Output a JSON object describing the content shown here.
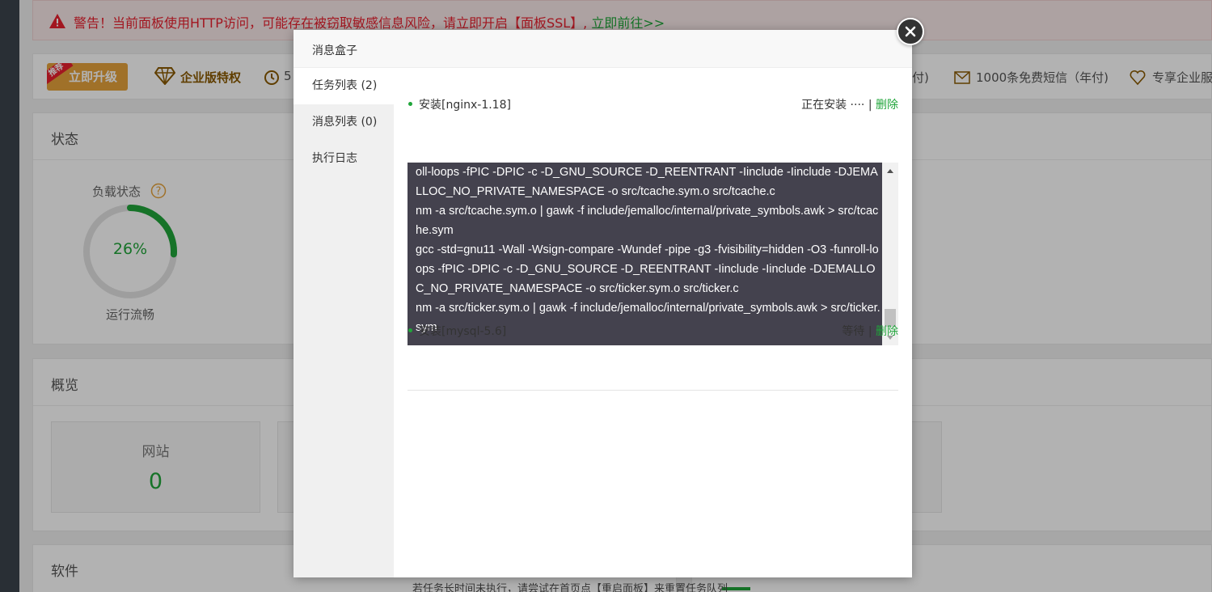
{
  "background": {
    "alert": {
      "text": "警告！当前面板使用HTTP访问，可能存在被窃取敏感信息风险，请立即开启【面板SSL】,",
      "link": " 立即前往>>"
    },
    "upgrade_bar": {
      "ribbon": "推荐",
      "upgrade_button": "立即升级",
      "enterprise_label": "企业版特权",
      "feature_partial_1": "5",
      "feature_partial_2": "付)",
      "feature_sms": "1000条免费短信（年付)",
      "feature_exclusive": "专享企业服务"
    },
    "status_panel": {
      "title": "状态",
      "load_label": "负载状态",
      "load_percent": "26%",
      "load_fraction": 0.26,
      "run_label": "运行流畅"
    },
    "overview_panel": {
      "title": "概览",
      "site_label": "网站",
      "site_count": "0"
    },
    "software_panel": {
      "title": "软件"
    }
  },
  "modal": {
    "title": "消息盒子",
    "tabs": [
      {
        "label": "任务列表 (2)",
        "active": true
      },
      {
        "label": "消息列表 (0)",
        "active": false
      },
      {
        "label": "执行日志",
        "active": false
      }
    ],
    "tasks": [
      {
        "name": "安装[nginx-1.18]",
        "status": "正在安装 ····",
        "separator": "|",
        "delete": "删除"
      },
      {
        "name": "安装[mysql-5.6]",
        "status": "等待",
        "separator": "|",
        "delete": "删除"
      }
    ],
    "log_lines": [
      "oll-loops -fPIC -DPIC -c -D_GNU_SOURCE -D_REENTRANT -Iinclude -Iinclude -DJEMALLOC_NO_PRIVATE_NAMESPACE -o src/tcache.sym.o src/tcache.c",
      "nm -a src/tcache.sym.o | gawk -f include/jemalloc/internal/private_symbols.awk > src/tcache.sym",
      "gcc -std=gnu11 -Wall -Wsign-compare -Wundef -pipe -g3 -fvisibility=hidden -O3 -funroll-loops -fPIC -DPIC -c -D_GNU_SOURCE -D_REENTRANT -Iinclude -Iinclude -DJEMALLOC_NO_PRIVATE_NAMESPACE -o src/ticker.sym.o src/ticker.c",
      "nm -a src/ticker.sym.o | gawk -f include/jemalloc/internal/private_symbols.awk > src/ticker.sym"
    ],
    "hint": "若任务长时间未执行，请尝试在首页点【重启面板】来重置任务队列",
    "colors": {
      "accent": "#20a53a",
      "log_bg": "#44424e",
      "alert_red": "#e8202e"
    }
  }
}
